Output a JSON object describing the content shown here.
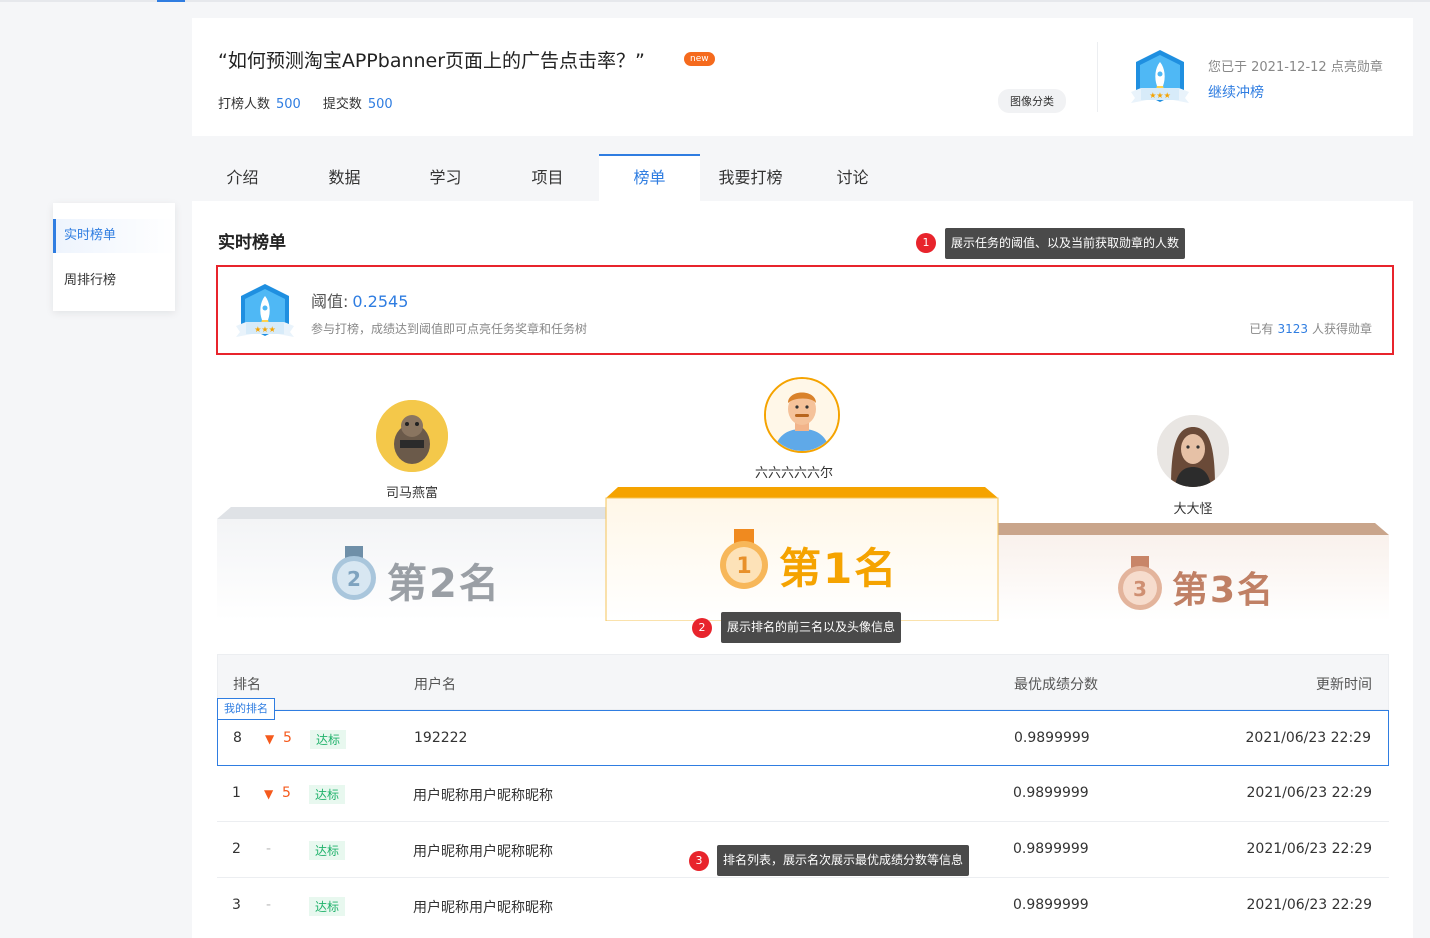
{
  "header": {
    "title": "“如何预测淘宝APPbanner页面上的广告点击率？”",
    "new_badge": "new",
    "participants_label": "打榜人数",
    "participants_value": "500",
    "submissions_label": "提交数",
    "submissions_value": "500",
    "category_tag": "图像分类",
    "lit_text": "您已于 2021-12-12 点亮勋章",
    "continue_link": "继续冲榜"
  },
  "tabs": [
    {
      "label": "介绍"
    },
    {
      "label": "数据"
    },
    {
      "label": "学习"
    },
    {
      "label": "项目"
    },
    {
      "label": "榜单",
      "active": true
    },
    {
      "label": "我要打榜"
    },
    {
      "label": "讨论"
    }
  ],
  "sidebar": {
    "items": [
      {
        "label": "实时榜单",
        "active": true
      },
      {
        "label": "周排行榜"
      }
    ]
  },
  "main": {
    "section_title": "实时榜单",
    "threshold": {
      "label": "阈值:",
      "value": "0.2545",
      "description": "参与打榜，成绩达到阈值即可点亮任务奖章和任务树",
      "count_prefix": "已有",
      "count_value": "3123",
      "count_suffix": "人获得勋章"
    },
    "annotations": [
      {
        "num": "1",
        "text": "展示任务的阈值、以及当前获取勋章的人数"
      },
      {
        "num": "2",
        "text": "展示排名的前三名以及头像信息"
      },
      {
        "num": "3",
        "text": "排名列表，展示名次展示最优成绩分数等信息"
      }
    ],
    "podium": {
      "first": {
        "name": "六六六六六尔",
        "rank_label": "第1名",
        "medal_num": "1"
      },
      "second": {
        "name": "司马燕富",
        "rank_label": "第2名",
        "medal_num": "2"
      },
      "third": {
        "name": "大大怪",
        "rank_label": "第3名",
        "medal_num": "3"
      }
    },
    "table": {
      "headers": {
        "rank": "排名",
        "username": "用户名",
        "score": "最优成绩分数",
        "time": "更新时间"
      },
      "my_rank_tag": "我的排名",
      "rows": [
        {
          "rank": "8",
          "change": "5",
          "change_dir": "down",
          "status": "达标",
          "username": "192222",
          "score": "0.9899999",
          "time": "2021/06/23  22:29"
        },
        {
          "rank": "1",
          "change": "5",
          "change_dir": "down",
          "status": "达标",
          "username": "用户昵称用户昵称昵称",
          "score": "0.9899999",
          "time": "2021/06/23  22:29"
        },
        {
          "rank": "2",
          "change": "-",
          "change_dir": "none",
          "status": "达标",
          "username": "用户昵称用户昵称昵称",
          "score": "0.9899999",
          "time": "2021/06/23  22:29"
        },
        {
          "rank": "3",
          "change": "-",
          "change_dir": "none",
          "status": "达标",
          "username": "用户昵称用户昵称昵称",
          "score": "0.9899999",
          "time": "2021/06/23  22:29"
        }
      ]
    }
  },
  "colors": {
    "accent": "#2f7de1",
    "gold": "#f5a300",
    "silver": "#cfd3d9",
    "bronze": "#c9a58b",
    "annotation_red": "#e8242c",
    "pass_green": "#20b26b",
    "down_orange": "#f55a1d"
  }
}
